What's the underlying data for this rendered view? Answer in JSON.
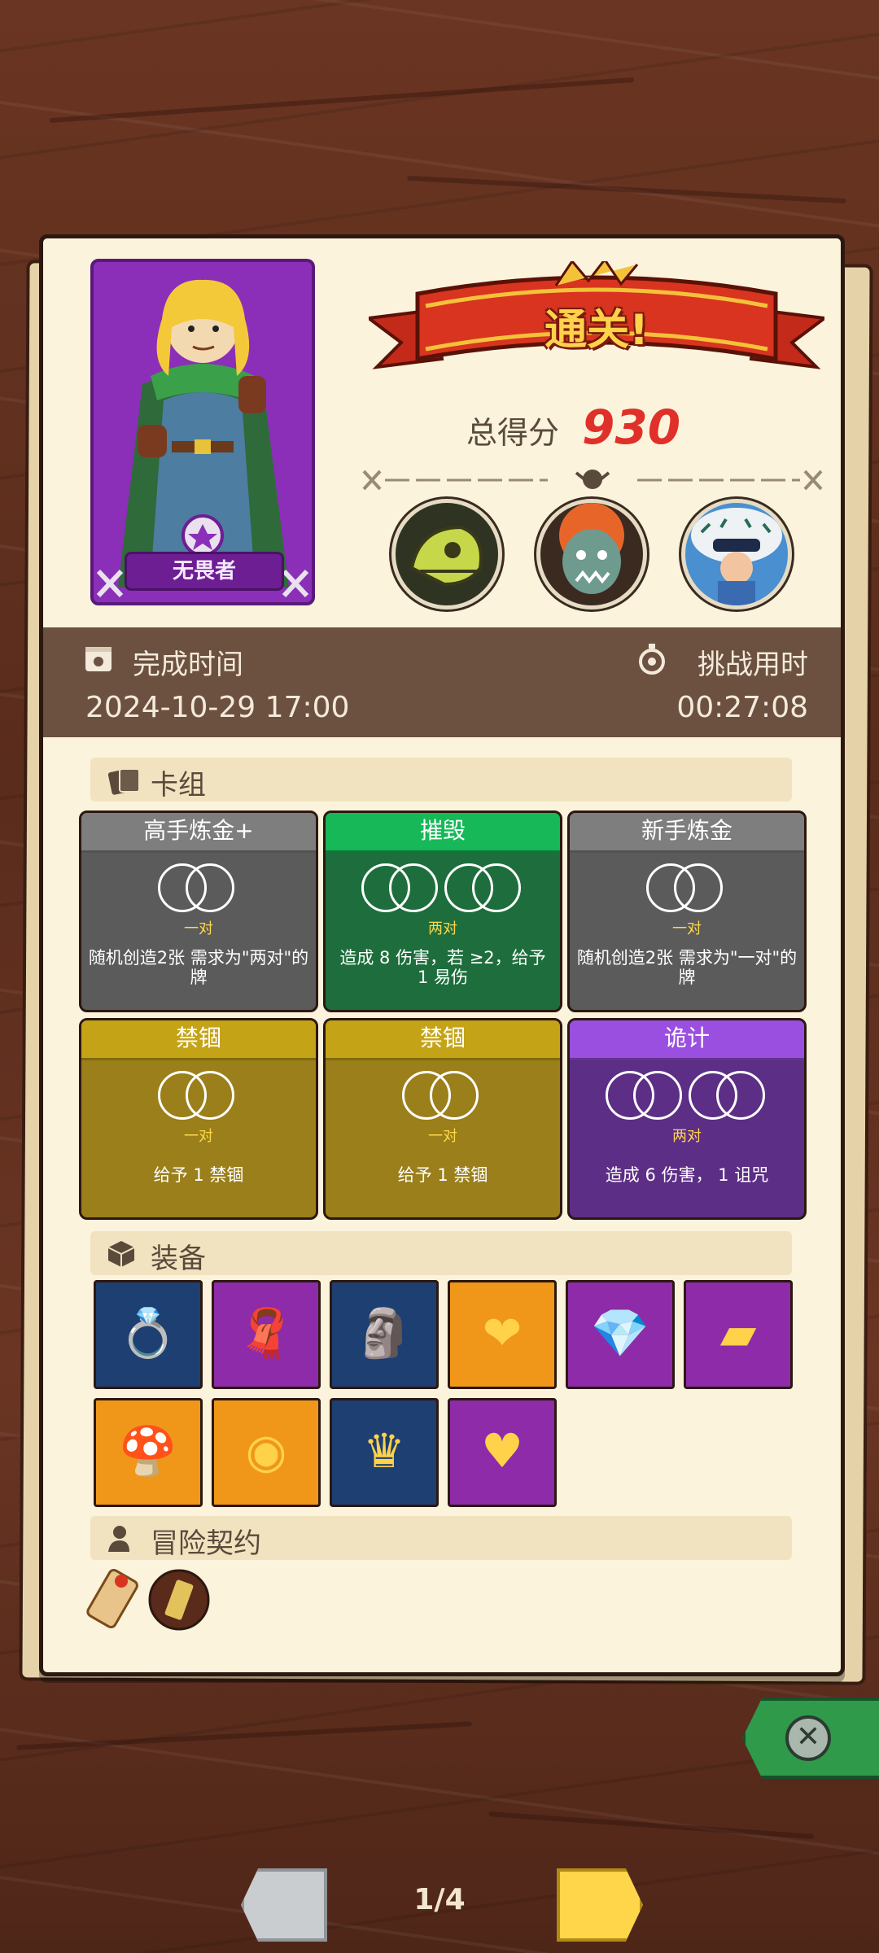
{
  "hero": {
    "name": "无畏者"
  },
  "result": {
    "title": "通关!",
    "score_label": "总得分",
    "score_value": "930"
  },
  "enemies": [
    "dino-skull-enemy",
    "orc-enemy",
    "masked-spirit-enemy"
  ],
  "times": {
    "complete_label": "完成时间",
    "complete_value": "2024-10-29 17:00",
    "challenge_label": "挑战用时",
    "challenge_value": "00:27:08"
  },
  "deck": {
    "title": "卡组",
    "cards": [
      {
        "name": "高手炼金+",
        "tag": "一对",
        "desc": "随机创造2张 需求为\"两对\"的牌",
        "color": "#5b5b5b",
        "head": "#7e7e7e"
      },
      {
        "name": "摧毁",
        "tag": "两对",
        "desc": "造成 8 伤害，若 ≥2，给予 1 易伤",
        "color": "#1d6e3c",
        "head": "#16b857"
      },
      {
        "name": "新手炼金",
        "tag": "一对",
        "desc": "随机创造2张 需求为\"一对\"的牌",
        "color": "#5b5b5b",
        "head": "#7e7e7e"
      },
      {
        "name": "禁锢",
        "tag": "一对",
        "desc": "给予 1 禁锢",
        "color": "#9a7f1a",
        "head": "#c4a316"
      },
      {
        "name": "禁锢",
        "tag": "一对",
        "desc": "给予 1 禁锢",
        "color": "#9a7f1a",
        "head": "#c4a316"
      },
      {
        "name": "诡计",
        "tag": "两对",
        "desc": "造成 6 伤害， 1 诅咒",
        "color": "#5c2e86",
        "head": "#9b4fe0"
      }
    ]
  },
  "equipment": {
    "title": "装备",
    "items": [
      {
        "icon": "gold-ring-icon",
        "color": "#1d3f72"
      },
      {
        "icon": "red-cloth-icon",
        "color": "#8e2ba8"
      },
      {
        "icon": "totem-icon",
        "color": "#1d3f72"
      },
      {
        "icon": "heart-box-icon",
        "color": "#f0971a"
      },
      {
        "icon": "gem-ring-icon",
        "color": "#8e2ba8"
      },
      {
        "icon": "gold-block-icon",
        "color": "#8e2ba8"
      },
      {
        "icon": "blue-mushroom-icon",
        "color": "#f0971a"
      },
      {
        "icon": "snail-shell-icon",
        "color": "#f0971a"
      },
      {
        "icon": "crystal-crown-icon",
        "color": "#1d3f72"
      },
      {
        "icon": "heart-amulet-icon",
        "color": "#8e2ba8"
      }
    ]
  },
  "contract": {
    "title": "冒险契约",
    "items": [
      "scroll-icon",
      "token-icon"
    ]
  },
  "pager": {
    "indicator": "1/4"
  }
}
